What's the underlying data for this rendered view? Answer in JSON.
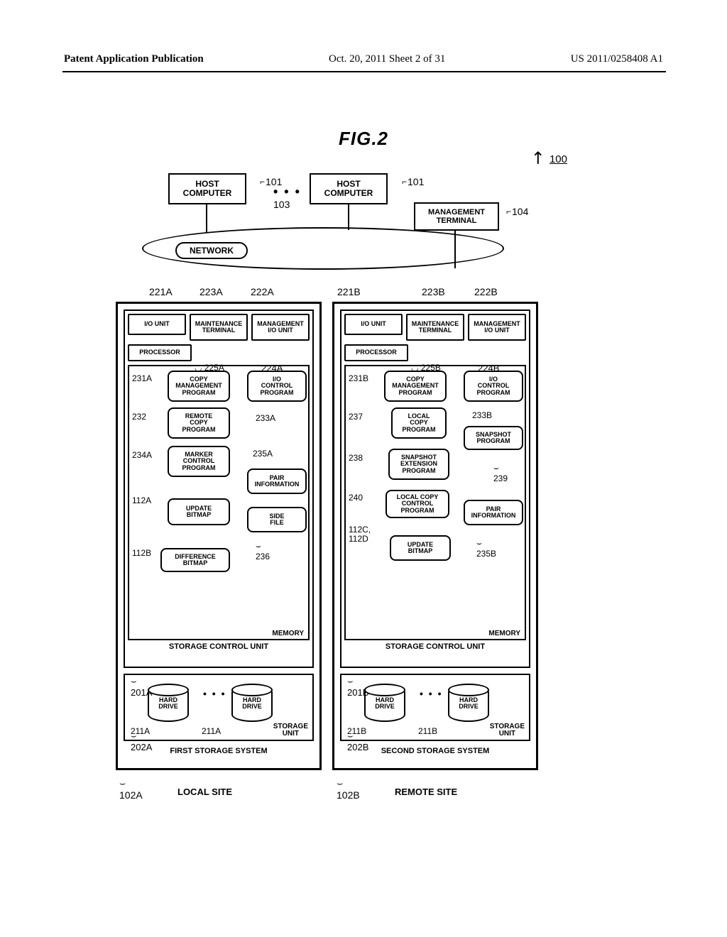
{
  "header": {
    "left": "Patent Application Publication",
    "center": "Oct. 20, 2011  Sheet 2 of 31",
    "right": "US 2011/0258408 A1"
  },
  "figure_title": "FIG.2",
  "system_ref": "100",
  "hosts": {
    "label": "HOST\nCOMPUTER",
    "ref": "101",
    "between_ref": "103"
  },
  "management_terminal_top": {
    "label": "MANAGEMENT\nTERMINAL",
    "ref": "104"
  },
  "network_label": "NETWORK",
  "site_left": {
    "ref": "102A",
    "title": "LOCAL SITE"
  },
  "site_right": {
    "ref": "102B",
    "title": "REMOTE SITE"
  },
  "storage_left": {
    "system_title": "FIRST STORAGE SYSTEM",
    "top_refs": {
      "io": "221A",
      "maint": "223A",
      "mgmt": "222A"
    },
    "io_unit": "I/O UNIT",
    "maintenance_terminal": "MAINTENANCE\nTERMINAL",
    "management_io_unit": "MANAGEMENT\nI/O UNIT",
    "processor": "PROCESSOR",
    "processor_ref": "225A",
    "memory_block_ref": "224A",
    "memory_label": "MEMORY",
    "scu_title": "STORAGE CONTROL UNIT",
    "scu_ref": "201A",
    "memory_items": {
      "copy_mgmt": {
        "label": "COPY\nMANAGEMENT\nPROGRAM",
        "ref": "231A"
      },
      "io_control": {
        "label": "I/O\nCONTROL\nPROGRAM",
        "ref": "233A"
      },
      "remote_copy": {
        "label": "REMOTE\nCOPY\nPROGRAM",
        "ref": "232"
      },
      "marker_ctrl": {
        "label": "MARKER\nCONTROL\nPROGRAM",
        "ref": "234A"
      },
      "pair_info": {
        "label": "PAIR\nINFORMATION",
        "ref": "235A"
      },
      "update_bitmap": {
        "label": "UPDATE\nBITMAP",
        "ref": "112A"
      },
      "side_file": {
        "label": "SIDE\nFILE",
        "ref": "236"
      },
      "diff_bitmap": {
        "label": "DIFFERENCE\nBITMAP",
        "ref": "112B"
      }
    },
    "storage_unit": {
      "title": "STORAGE\nUNIT",
      "hard_drive": "HARD\nDRIVE",
      "drive_ref": "211A",
      "unit_ref": "202A"
    }
  },
  "storage_right": {
    "system_title": "SECOND STORAGE SYSTEM",
    "top_refs": {
      "io": "221B",
      "maint": "223B",
      "mgmt": "222B"
    },
    "io_unit": "I/O UNIT",
    "maintenance_terminal": "MAINTENANCE\nTERMINAL",
    "management_io_unit": "MANAGEMENT\nI/O UNIT",
    "processor": "PROCESSOR",
    "processor_ref": "225B",
    "memory_block_ref": "224B",
    "memory_label": "MEMORY",
    "scu_title": "STORAGE CONTROL UNIT",
    "scu_ref": "201B",
    "memory_items": {
      "copy_mgmt": {
        "label": "COPY\nMANAGEMENT\nPROGRAM",
        "ref": "231B"
      },
      "io_control": {
        "label": "I/O\nCONTROL\nPROGRAM",
        "ref": "233B"
      },
      "local_copy": {
        "label": "LOCAL\nCOPY\nPROGRAM",
        "ref": "237"
      },
      "snapshot": {
        "label": "SNAPSHOT\nPROGRAM",
        "ref": "239"
      },
      "snapshot_ext": {
        "label": "SNAPSHOT\nEXTENSION\nPROGRAM",
        "ref": "238"
      },
      "local_copy_ctrl": {
        "label": "LOCAL COPY\nCONTROL\nPROGRAM",
        "ref": "240"
      },
      "pair_info": {
        "label": "PAIR\nINFORMATION",
        "ref": "235B"
      },
      "update_bitmap": {
        "label": "UPDATE\nBITMAP",
        "ref": "112C,\n112D"
      }
    },
    "storage_unit": {
      "title": "STORAGE\nUNIT",
      "hard_drive": "HARD\nDRIVE",
      "drive_ref": "211B",
      "unit_ref": "202B"
    }
  }
}
